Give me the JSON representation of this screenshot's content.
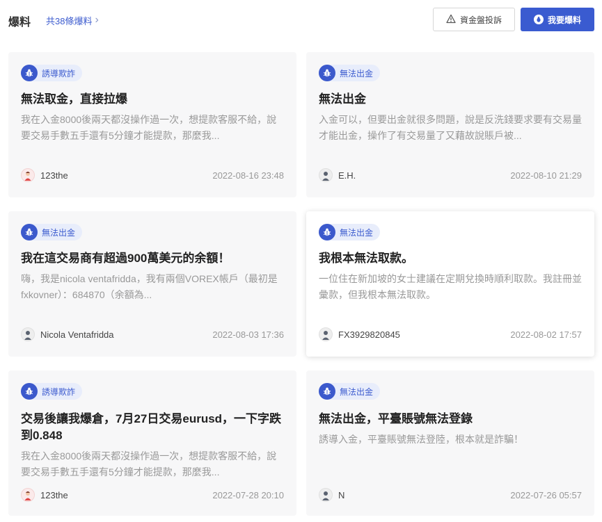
{
  "header": {
    "title": "爆料",
    "count_text": "共38條爆料",
    "chevron": "›",
    "complaint_button": "資金盤投訴",
    "report_button": "我要爆料"
  },
  "colors": {
    "accent": "#3a5bd0",
    "tag_bg": "#e8edfb",
    "card_bg": "#f7f7f8",
    "muted_text": "#999999"
  },
  "cards": [
    {
      "tag": "誘導欺詐",
      "tag_icon": "bug-icon",
      "title": "無法取金，直接拉爆",
      "body": "我在入金8000後兩天都沒操作過一次，想提款客服不給，說要交易手數五手還有5分鐘才能提款，那麼我...",
      "user": "123the",
      "avatar": "person-red-icon",
      "date": "2022-08-16 23:48"
    },
    {
      "tag": "無法出金",
      "tag_icon": "bug-icon",
      "title": "無法出金",
      "body": "入金可以，但要出金就很多問題，說是反洗錢要求要有交易量才能出金，操作了有交易量了又藉故說賬戶被...",
      "user": "E.H.",
      "avatar": "person-gray-icon",
      "date": "2022-08-10 21:29"
    },
    {
      "tag": "無法出金",
      "tag_icon": "bug-icon",
      "title": "我在這交易商有超過900萬美元的余額！",
      "body": "嗨，我是nicola ventafridda，我有兩個VOREX帳戶（最初是 fxkovner）：684870（余額為...",
      "user": "Nicola Ventafridda",
      "avatar": "person-gray-icon",
      "date": "2022-08-03 17:36"
    },
    {
      "tag": "無法出金",
      "tag_icon": "bug-icon",
      "title": "我根本無法取款。",
      "body": "一位住在新加坡的女士建議在定期兌換時順利取款。我註冊並彙款，但我根本無法取款。",
      "user": "FX3929820845",
      "avatar": "person-gray-icon",
      "date": "2022-08-02 17:57"
    },
    {
      "tag": "誘導欺詐",
      "tag_icon": "bug-icon",
      "title": "交易後讓我爆倉，7月27日交易eurusd，一下字跌到0.848",
      "body": "我在入金8000後兩天都沒操作過一次，想提款客服不給，說要交易手數五手還有5分鐘才能提款，那麼我...",
      "user": "123the",
      "avatar": "person-red-icon",
      "date": "2022-07-28 20:10"
    },
    {
      "tag": "無法出金",
      "tag_icon": "bug-icon",
      "title": "無法出金，平臺賬號無法登錄",
      "body": "誘導入金，平臺賬號無法登陸，根本就是詐騙！",
      "user": "N",
      "avatar": "person-gray-icon",
      "date": "2022-07-26 05:57"
    }
  ]
}
